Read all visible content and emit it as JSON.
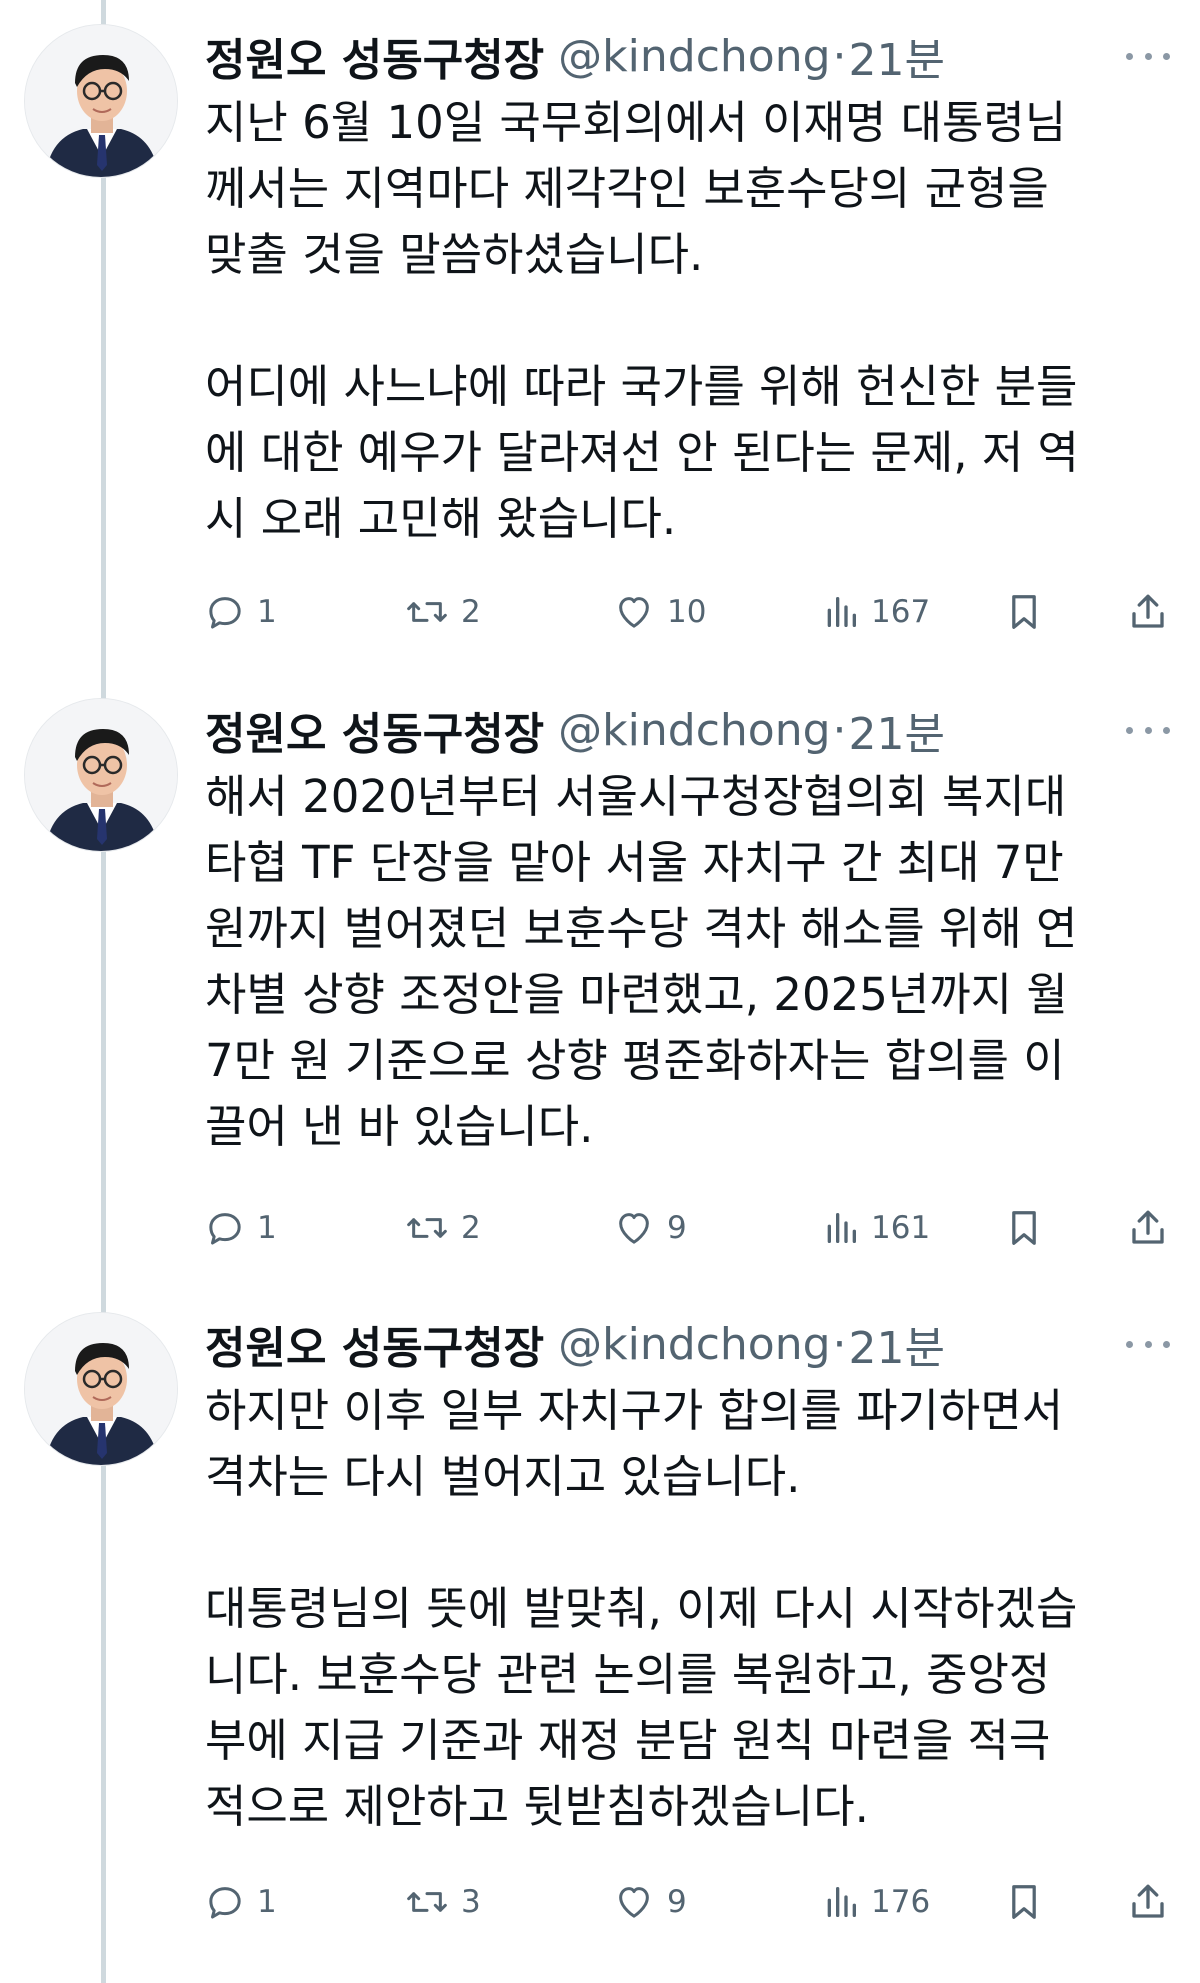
{
  "thread": {
    "tweets": [
      {
        "author_name": "정원오 성동구청장",
        "handle": "@kindchong",
        "separator": "·",
        "time": "21분",
        "lines": [
          "지난 6월 10일 국무회의에서 이재명 대통령님",
          "께서는 지역마다 제각각인 보훈수당의 균형을",
          "맞출 것을 말씀하셨습니다.",
          "",
          "어디에 사느냐에 따라 국가를 위해 헌신한 분들",
          "에 대한 예우가 달라져선 안 된다는 문제, 저 역",
          "시 오래 고민해 왔습니다."
        ],
        "replies": "1",
        "retweets": "2",
        "likes": "10",
        "views": "167"
      },
      {
        "author_name": "정원오 성동구청장",
        "handle": "@kindchong",
        "separator": "·",
        "time": "21분",
        "lines": [
          "해서 2020년부터 서울시구청장협의회 복지대",
          "타협 TF 단장을 맡아 서울 자치구 간 최대 7만",
          "원까지 벌어졌던 보훈수당 격차 해소를 위해 연",
          "차별 상향 조정안을 마련했고, 2025년까지 월",
          "7만 원 기준으로 상향 평준화하자는 합의를 이",
          "끌어 낸 바 있습니다."
        ],
        "replies": "1",
        "retweets": "2",
        "likes": "9",
        "views": "161"
      },
      {
        "author_name": "정원오 성동구청장",
        "handle": "@kindchong",
        "separator": "·",
        "time": "21분",
        "lines": [
          "하지만 이후 일부 자치구가 합의를 파기하면서",
          "격차는 다시 벌어지고 있습니다.",
          "",
          "대통령님의 뜻에 발맞춰, 이제 다시 시작하겠습",
          "니다. 보훈수당 관련 논의를 복원하고, 중앙정",
          "부에 지급 기준과 재정 분담 원칙 마련을 적극",
          "적으로 제안하고 뒷받침하겠습니다."
        ],
        "replies": "1",
        "retweets": "3",
        "likes": "9",
        "views": "176"
      }
    ]
  },
  "icons": {
    "reply": "reply-icon",
    "retweet": "retweet-icon",
    "like": "heart-icon",
    "views": "views-chart-icon",
    "bookmark": "bookmark-icon",
    "share": "share-icon",
    "more": "more-dots-icon"
  },
  "colors": {
    "text": "#0f1419",
    "secondary": "#536471",
    "thread_line": "#cfd9de",
    "background": "#ffffff"
  }
}
